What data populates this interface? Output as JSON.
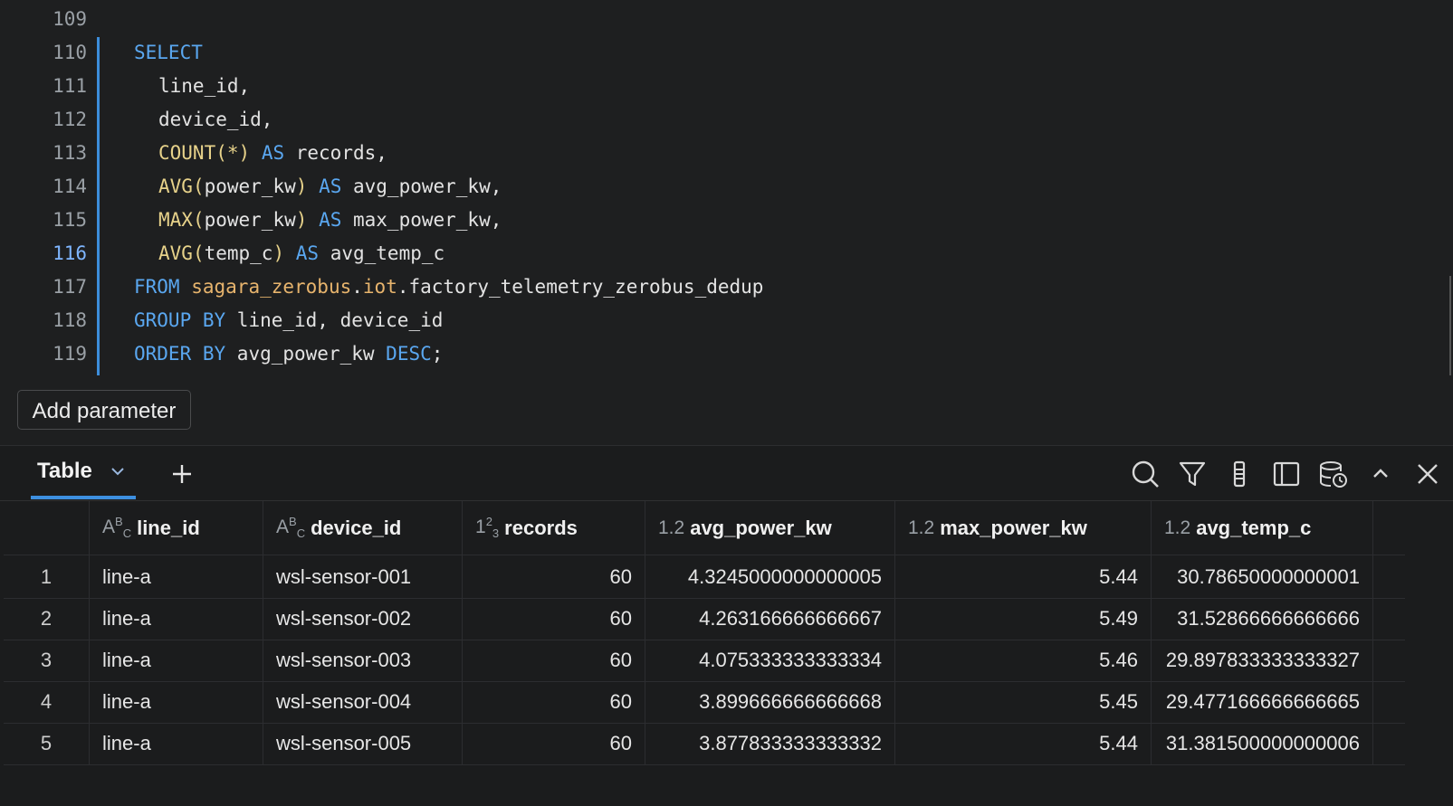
{
  "editor": {
    "lines": [
      {
        "n": "109",
        "html": ""
      },
      {
        "n": "110",
        "html": "<span class=\"kw\">SELECT</span>"
      },
      {
        "n": "111",
        "html": "<span class=\"in\"></span>line_id,"
      },
      {
        "n": "112",
        "html": "<span class=\"in\"></span>device_id,"
      },
      {
        "n": "113",
        "html": "<span class=\"in\"></span><span class=\"fn\">COUNT</span><span class=\"br\">(*)</span> <span class=\"kw\">AS</span> records,"
      },
      {
        "n": "114",
        "html": "<span class=\"in\"></span><span class=\"fn\">AVG</span><span class=\"br\">(</span>power_kw<span class=\"br\">)</span> <span class=\"kw\">AS</span> avg_power_kw,"
      },
      {
        "n": "115",
        "html": "<span class=\"in\"></span><span class=\"fn\">MAX</span><span class=\"br\">(</span>power_kw<span class=\"br\">)</span> <span class=\"kw\">AS</span> max_power_kw,"
      },
      {
        "n": "116",
        "html": "<span class=\"in\"></span><span class=\"fn\">AVG</span><span class=\"br\">(</span>temp_c<span class=\"br\">)</span> <span class=\"kw\">AS</span> avg_temp_c",
        "active": true
      },
      {
        "n": "117",
        "html": "<span class=\"kw\">FROM</span> <span class=\"tb\">sagara_zerobus</span>.<span class=\"tb\">iot</span>.factory_telemetry_zerobus_dedup"
      },
      {
        "n": "118",
        "html": "<span class=\"kw\">GROUP BY</span> line_id, device_id"
      },
      {
        "n": "119",
        "html": "<span class=\"kw\">ORDER BY</span> avg_power_kw <span class=\"kw\">DESC</span>;"
      }
    ],
    "add_parameter_label": "Add parameter"
  },
  "results": {
    "tab_label": "Table",
    "icons": {
      "chevron": "chevron-down-icon",
      "add": "plus-icon",
      "search": "search-icon",
      "filter": "filter-icon",
      "columns": "columns-icon",
      "panel": "panel-icon",
      "data": "database-clock-icon",
      "collapse": "chevron-up-icon",
      "close": "close-icon"
    },
    "columns": [
      {
        "type": "ABC",
        "name": "line_id"
      },
      {
        "type": "123",
        "name": "device_id"
      },
      {
        "type": "123",
        "name": "records"
      },
      {
        "type": "1.2",
        "name": "avg_power_kw"
      },
      {
        "type": "1.2",
        "name": "max_power_kw"
      },
      {
        "type": "1.2",
        "name": "avg_temp_c"
      }
    ],
    "rows": [
      [
        "1",
        "line-a",
        "wsl-sensor-001",
        "60",
        "4.3245000000000005",
        "5.44",
        "30.78650000000001"
      ],
      [
        "2",
        "line-a",
        "wsl-sensor-002",
        "60",
        "4.263166666666667",
        "5.49",
        "31.52866666666666"
      ],
      [
        "3",
        "line-a",
        "wsl-sensor-003",
        "60",
        "4.075333333333334",
        "5.46",
        "29.897833333333327"
      ],
      [
        "4",
        "line-a",
        "wsl-sensor-004",
        "60",
        "3.899666666666668",
        "5.45",
        "29.477166666666665"
      ],
      [
        "5",
        "line-a",
        "wsl-sensor-005",
        "60",
        "3.877833333333332",
        "5.44",
        "31.381500000000006"
      ]
    ]
  },
  "colors": {
    "background": "#1e1f20",
    "keyword": "#5aa7f0",
    "function": "#e7d28a",
    "table_name": "#e7b46d",
    "accent": "#3d8fe0"
  }
}
